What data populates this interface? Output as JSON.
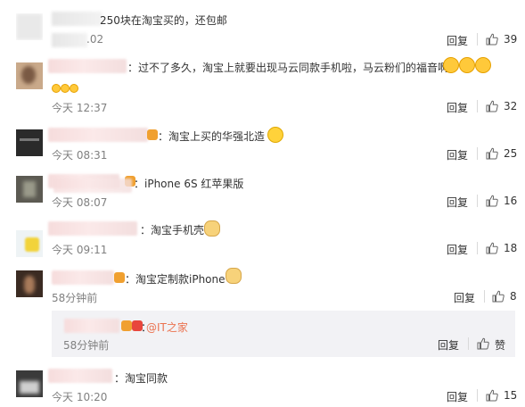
{
  "comments": [
    {
      "text": "250块在淘宝买的，还包邮",
      "time": ".02",
      "reply": "回复",
      "likes": "39"
    },
    {
      "text": "：过不了多久，淘宝上就要出现马云同款手机啦，马云粉们的福音啊",
      "time": "今天 12:37",
      "reply": "回复",
      "likes": "32"
    },
    {
      "text": "：淘宝上买的华强北造",
      "time": "今天 08:31",
      "reply": "回复",
      "likes": "25"
    },
    {
      "text": "：iPhone 6S 红苹果版",
      "time": "今天 08:07",
      "reply": "回复",
      "likes": "16"
    },
    {
      "text": "：淘宝手机壳",
      "time": "今天 09:11",
      "reply": "回复",
      "likes": "18"
    },
    {
      "text": "：淘宝定制款iPhone",
      "time": "58分钟前",
      "reply": "回复",
      "likes": "8"
    },
    {
      "text": "：淘宝同款",
      "time": "今天 10:20",
      "reply": "回复",
      "likes": "15"
    }
  ],
  "nested_reply": {
    "prefix": "：",
    "mention": "@IT之家",
    "time": "58分钟前",
    "reply": "回复",
    "like_label": "赞"
  },
  "icons": {
    "like": "thumbs-up-icon",
    "laugh": "laughing-emoji-icon",
    "dog": "doge-emoji-icon",
    "hug": "hug-emoji-icon",
    "badge": "member-badge-icon"
  },
  "colors": {
    "link": "#eb7350",
    "time": "#808080",
    "text": "#333333",
    "reply_bg": "#f2f2f5"
  }
}
